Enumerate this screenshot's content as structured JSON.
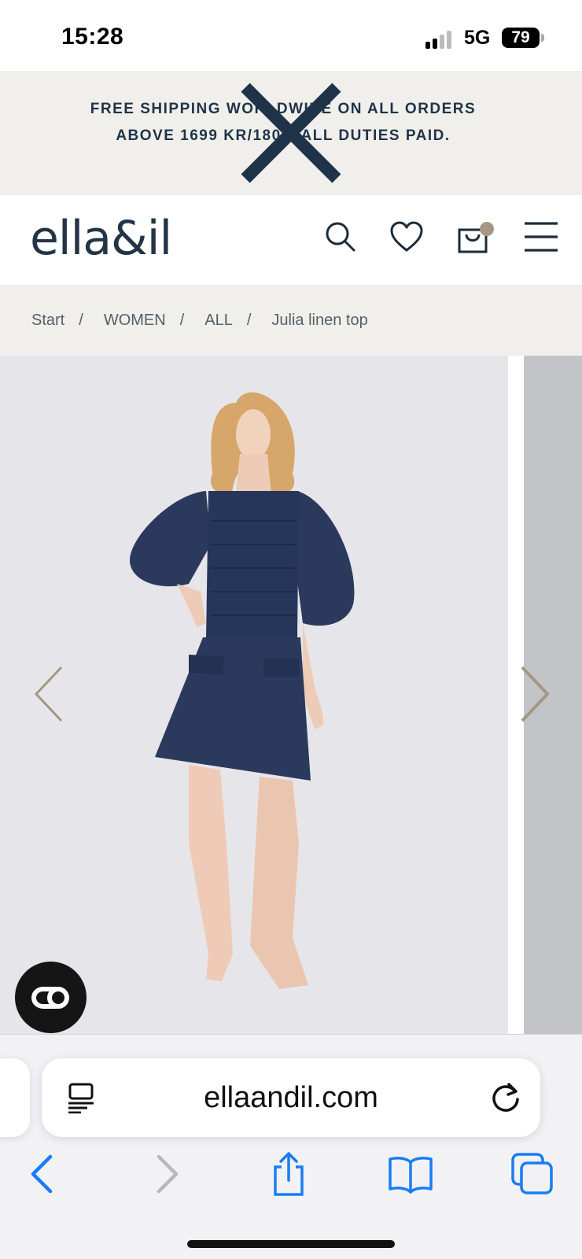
{
  "status_bar": {
    "time": "15:28",
    "network": "5G",
    "battery": "79"
  },
  "promo": {
    "line1": "FREE SHIPPING WORLDWIDE ON ALL ORDERS",
    "line2": "ABOVE 1699 KR/180€. ALL DUTIES PAID."
  },
  "header": {
    "logo": "ella&il",
    "icons": [
      "search-icon",
      "heart-icon",
      "bag-icon",
      "menu-icon"
    ]
  },
  "breadcrumb": [
    {
      "label": "Start",
      "sep": "/"
    },
    {
      "label": "WOMEN",
      "sep": "/"
    },
    {
      "label": "ALL",
      "sep": "/"
    },
    {
      "label": "Julia linen top",
      "sep": ""
    }
  ],
  "gallery": {
    "colors": {
      "background": "#e6e6ea",
      "garment": "#2b3a5c",
      "arrow": "#a59784"
    }
  },
  "browser": {
    "url": "ellaandil.com",
    "toolbar": [
      "back-icon",
      "forward-icon",
      "share-icon",
      "bookmarks-icon",
      "tabs-icon"
    ]
  }
}
